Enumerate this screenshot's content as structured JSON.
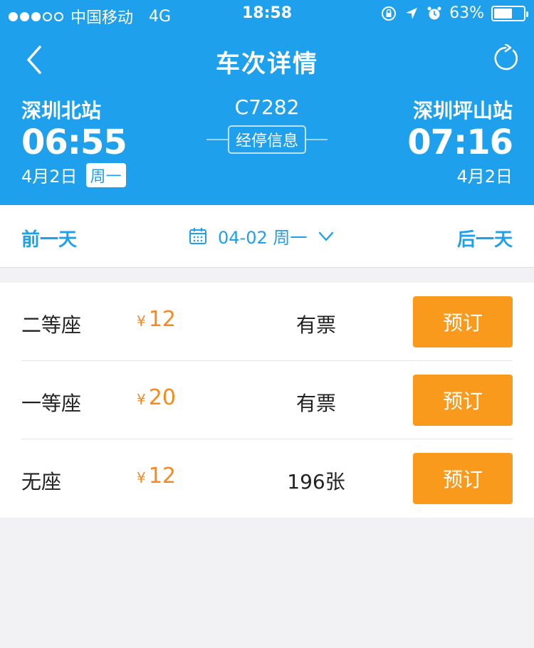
{
  "status_bar": {
    "carrier": "中国移动",
    "network": "4G",
    "time": "18:58",
    "battery": "63%",
    "battery_level": 0.63,
    "signal_dots_filled": 3,
    "signal_dots_total": 5
  },
  "nav": {
    "title": "车次详情",
    "back_icon": "chevron-left-icon",
    "refresh_icon": "refresh-icon"
  },
  "train": {
    "number": "C7282",
    "stop_info_label": "经停信息",
    "departure": {
      "station": "深圳北站",
      "time": "06:55",
      "date": "4月2日",
      "weekday": "周一"
    },
    "arrival": {
      "station": "深圳坪山站",
      "time": "07:16",
      "date": "4月2日"
    }
  },
  "date_bar": {
    "prev_label": "前一天",
    "next_label": "后一天",
    "selected_date": "04-02 周一",
    "calendar_icon": "calendar-icon",
    "dropdown_icon": "chevron-down-icon"
  },
  "seats": [
    {
      "name": "二等座",
      "currency": "¥",
      "price": "12",
      "availability": "有票",
      "button": "预订"
    },
    {
      "name": "一等座",
      "currency": "¥",
      "price": "20",
      "availability": "有票",
      "button": "预订"
    },
    {
      "name": "无座",
      "currency": "¥",
      "price": "12",
      "availability": "196张",
      "button": "预订"
    }
  ],
  "colors": {
    "primary_blue": "#1fa0ec",
    "price_orange": "#f7891e",
    "button_orange": "#fa9a1c",
    "background": "#f2f2f4"
  }
}
